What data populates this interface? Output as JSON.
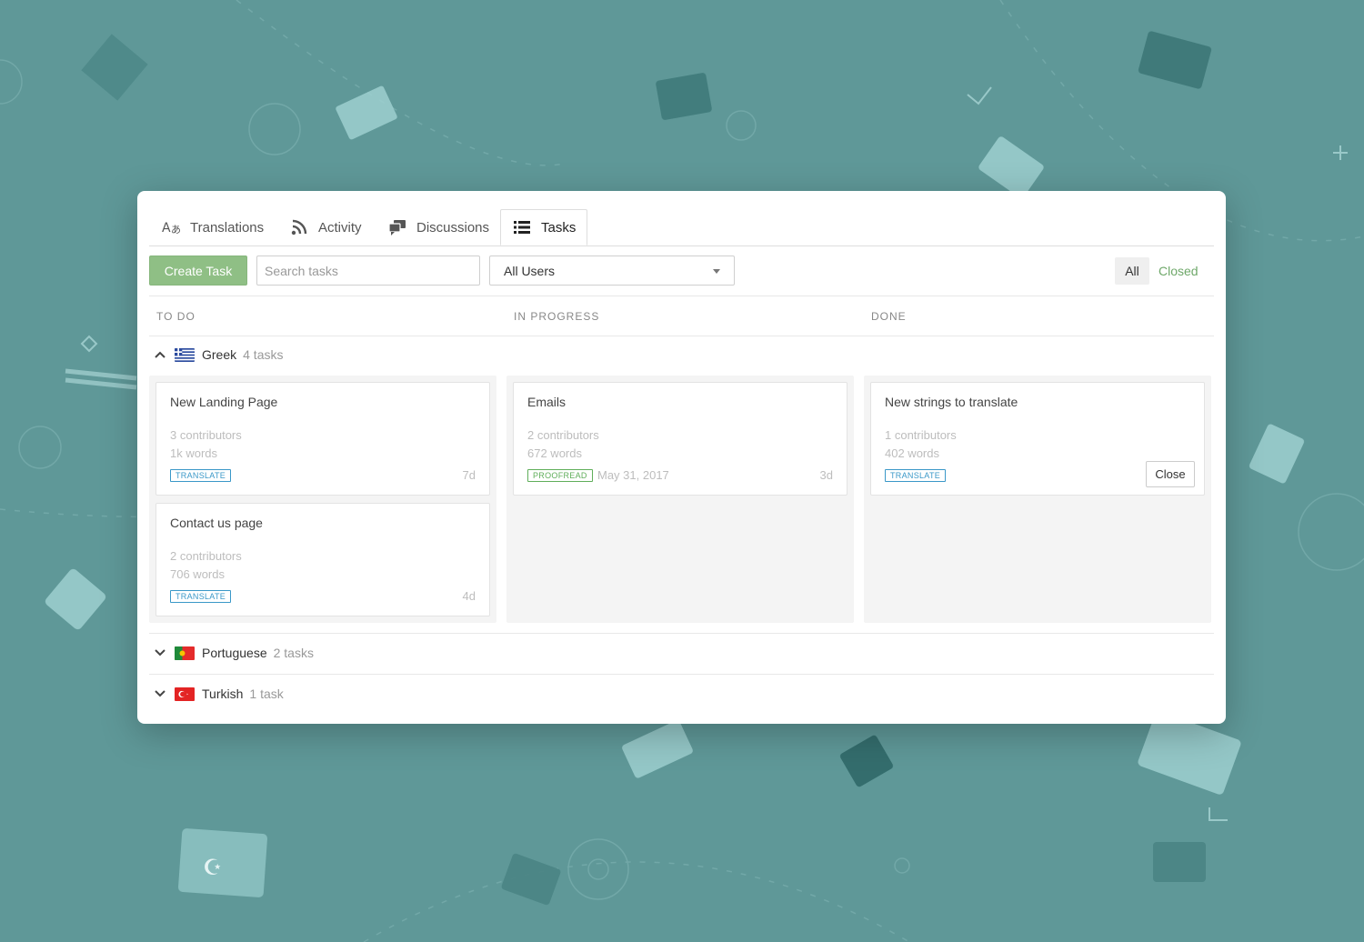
{
  "tabs": [
    {
      "label": "Translations",
      "icon": "translate-icon"
    },
    {
      "label": "Activity",
      "icon": "rss-icon"
    },
    {
      "label": "Discussions",
      "icon": "chat-icon"
    },
    {
      "label": "Tasks",
      "icon": "list-icon",
      "active": true
    }
  ],
  "toolbar": {
    "create_label": "Create Task",
    "search_placeholder": "Search tasks",
    "users_selected": "All Users",
    "filter_all": "All",
    "filter_closed": "Closed"
  },
  "columns": [
    "TO DO",
    "IN PROGRESS",
    "DONE"
  ],
  "groups": [
    {
      "language": "Greek",
      "count": "4 tasks",
      "expanded": true,
      "todo": [
        {
          "title": "New Landing Page",
          "contributors": "3 contributors",
          "words": "1k words",
          "badge": "TRANSLATE",
          "age": "7d"
        },
        {
          "title": "Contact us page",
          "contributors": "2 contributors",
          "words": "706 words",
          "badge": "TRANSLATE",
          "age": "4d"
        }
      ],
      "in_progress": [
        {
          "title": "Emails",
          "contributors": "2 contributors",
          "words": "672 words",
          "badge": "PROOFREAD",
          "due": "May 31, 2017",
          "age": "3d"
        }
      ],
      "done": [
        {
          "title": "New strings to translate",
          "contributors": "1 contributors",
          "words": "402 words",
          "badge": "TRANSLATE",
          "action": "Close"
        }
      ]
    },
    {
      "language": "Portuguese",
      "count": "2 tasks",
      "expanded": false
    },
    {
      "language": "Turkish",
      "count": "1 task",
      "expanded": false
    }
  ],
  "colors": {
    "background": "#5f9898",
    "accent_green": "#8fbf85",
    "closed_link": "#6fa86a",
    "translate_badge": "#3a98c8",
    "proofread_badge": "#5fae5a"
  }
}
